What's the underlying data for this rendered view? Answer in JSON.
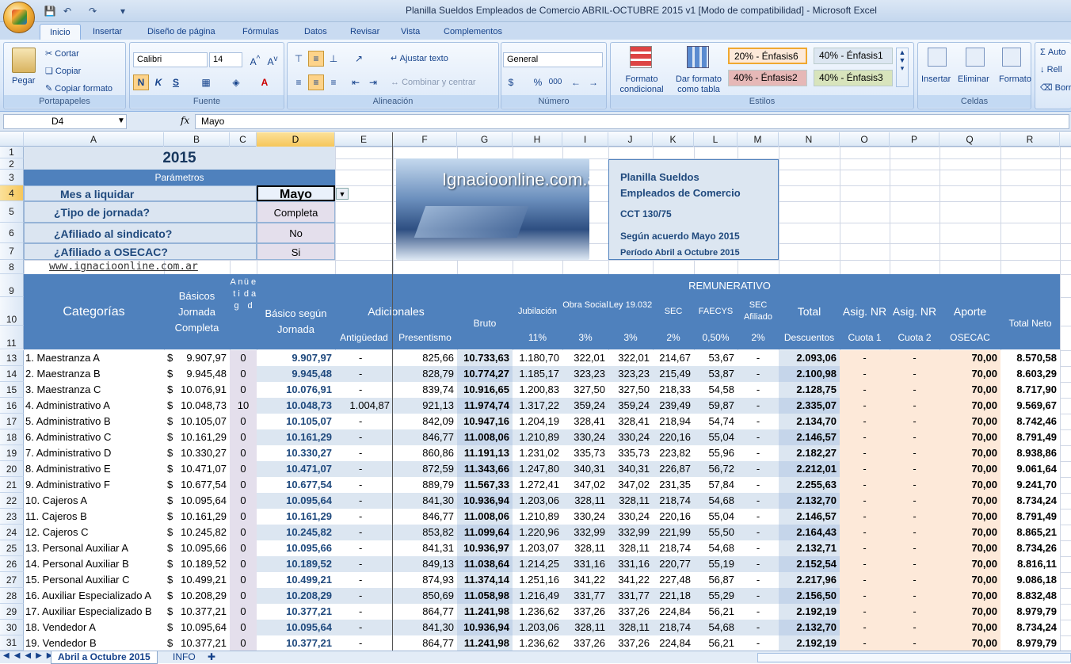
{
  "window": {
    "title": "Planilla Sueldos Empleados de Comercio ABRIL-OCTUBRE 2015 v1  [Modo de compatibilidad] - Microsoft Excel"
  },
  "tabs": [
    "Inicio",
    "Insertar",
    "Diseño de página",
    "Fórmulas",
    "Datos",
    "Revisar",
    "Vista",
    "Complementos"
  ],
  "ribbon": {
    "clipboard": {
      "label": "Portapapeles",
      "paste": "Pegar",
      "cut": "Cortar",
      "copy": "Copiar",
      "format_painter": "Copiar formato"
    },
    "font": {
      "label": "Fuente",
      "name": "Calibri",
      "size": "14",
      "bold": "N",
      "italic": "K",
      "underline": "S"
    },
    "alignment": {
      "label": "Alineación",
      "wrap": "Ajustar texto",
      "merge": "Combinar y centrar"
    },
    "number": {
      "label": "Número",
      "format": "General",
      "currency": "$",
      "percent": "%",
      "thousands": "000"
    },
    "styles": {
      "label": "Estilos",
      "conditional": "Formato condicional",
      "as_table": "Dar formato como tabla",
      "cells": [
        "20% - Énfasis6",
        "40% - Énfasis1",
        "40% - Énfasis2",
        "40% - Énfasis3"
      ],
      "cell_colors": [
        "#fde9d9",
        "#dce6f1",
        "#e6b8b7",
        "#d8e4bc"
      ]
    },
    "cells": {
      "label": "Celdas",
      "insert": "Insertar",
      "delete": "Eliminar",
      "format": "Formato"
    },
    "editing": {
      "items": [
        "Auto",
        "Rell",
        "Borr"
      ]
    }
  },
  "formula_bar": {
    "name_box": "D4",
    "fx": "fx",
    "value": "Mayo"
  },
  "columns": [
    "A",
    "B",
    "C",
    "D",
    "E",
    "F",
    "G",
    "H",
    "I",
    "J",
    "K",
    "L",
    "M",
    "N",
    "O",
    "P",
    "Q",
    "R"
  ],
  "rows": [
    "1",
    "2",
    "3",
    "4",
    "5",
    "6",
    "7",
    "8",
    "9",
    "10",
    "11",
    "13",
    "14",
    "15",
    "16",
    "17",
    "18",
    "19",
    "20",
    "21",
    "22",
    "23",
    "24",
    "25",
    "26",
    "27",
    "28",
    "29",
    "30",
    "31"
  ],
  "params": {
    "year": "2015",
    "title": "Parámetros",
    "mes_label": "Mes a liquidar",
    "mes_value": "Mayo",
    "jornada_label": "¿Tipo de jornada?",
    "jornada_value": "Completa",
    "sindicato_label": "¿Afiliado al sindicato?",
    "sindicato_value": "No",
    "osecac_label": "¿Afiliado a OSECAC?",
    "osecac_value": "Si",
    "website": "www.ignacioonline.com.ar"
  },
  "banner": {
    "logo_text": "Ignacioonline.com.ar",
    "info": [
      "Planilla Sueldos",
      "Empleados de Comercio",
      "CCT 130/75",
      "Según acuerdo Mayo 2015",
      "Período Abril a Octubre 2015"
    ]
  },
  "headers": {
    "categorias": "Categorías",
    "basicos": "Básicos Jornada Completa",
    "antig": "A n t i g",
    "edad": "ü e d a d",
    "basico_jornada": "Básico según Jornada",
    "adicionales": "Adicionales",
    "antiguedad": "Antigüedad",
    "presentismo": "Presentismo",
    "remunerativo": "REMUNERATIVO",
    "bruto": "Bruto",
    "jubilacion": "Jubilación",
    "jub_pct": "11%",
    "obra_social": "Obra Social",
    "os_pct": "3%",
    "ley": "Ley 19.032",
    "ley_pct": "3%",
    "sec": "SEC",
    "sec_pct": "2%",
    "faecys": "FAECYS",
    "faecys_pct": "0,50%",
    "sec_afiliado": "SEC Afiliado",
    "seca_pct": "2%",
    "total": "Total",
    "descuentos": "Descuentos",
    "asig1": "Asig. NR",
    "cuota1": "Cuota 1",
    "asig2": "Asig. NR",
    "cuota2": "Cuota 2",
    "aporte": "Aporte",
    "osecac": "OSECAC",
    "total_neto": "Total Neto"
  },
  "table": [
    [
      "1. Maestranza A",
      "$",
      "9.907,97",
      "0",
      "9.907,97",
      "-",
      "825,66",
      "10.733,63",
      "1.180,70",
      "322,01",
      "322,01",
      "214,67",
      "53,67",
      "-",
      "2.093,06",
      "-",
      "-",
      "70,00",
      "8.570,58"
    ],
    [
      "2. Maestranza B",
      "$",
      "9.945,48",
      "0",
      "9.945,48",
      "-",
      "828,79",
      "10.774,27",
      "1.185,17",
      "323,23",
      "323,23",
      "215,49",
      "53,87",
      "-",
      "2.100,98",
      "-",
      "-",
      "70,00",
      "8.603,29"
    ],
    [
      "3. Maestranza C",
      "$",
      "10.076,91",
      "0",
      "10.076,91",
      "-",
      "839,74",
      "10.916,65",
      "1.200,83",
      "327,50",
      "327,50",
      "218,33",
      "54,58",
      "-",
      "2.128,75",
      "-",
      "-",
      "70,00",
      "8.717,90"
    ],
    [
      "4. Administrativo A",
      "$",
      "10.048,73",
      "10",
      "10.048,73",
      "1.004,87",
      "921,13",
      "11.974,74",
      "1.317,22",
      "359,24",
      "359,24",
      "239,49",
      "59,87",
      "-",
      "2.335,07",
      "-",
      "-",
      "70,00",
      "9.569,67"
    ],
    [
      "5. Administrativo B",
      "$",
      "10.105,07",
      "0",
      "10.105,07",
      "-",
      "842,09",
      "10.947,16",
      "1.204,19",
      "328,41",
      "328,41",
      "218,94",
      "54,74",
      "-",
      "2.134,70",
      "-",
      "-",
      "70,00",
      "8.742,46"
    ],
    [
      "6. Administrativo C",
      "$",
      "10.161,29",
      "0",
      "10.161,29",
      "-",
      "846,77",
      "11.008,06",
      "1.210,89",
      "330,24",
      "330,24",
      "220,16",
      "55,04",
      "-",
      "2.146,57",
      "-",
      "-",
      "70,00",
      "8.791,49"
    ],
    [
      "7. Administrativo D",
      "$",
      "10.330,27",
      "0",
      "10.330,27",
      "-",
      "860,86",
      "11.191,13",
      "1.231,02",
      "335,73",
      "335,73",
      "223,82",
      "55,96",
      "-",
      "2.182,27",
      "-",
      "-",
      "70,00",
      "8.938,86"
    ],
    [
      "8. Administrativo E",
      "$",
      "10.471,07",
      "0",
      "10.471,07",
      "-",
      "872,59",
      "11.343,66",
      "1.247,80",
      "340,31",
      "340,31",
      "226,87",
      "56,72",
      "-",
      "2.212,01",
      "-",
      "-",
      "70,00",
      "9.061,64"
    ],
    [
      "9. Administrativo F",
      "$",
      "10.677,54",
      "0",
      "10.677,54",
      "-",
      "889,79",
      "11.567,33",
      "1.272,41",
      "347,02",
      "347,02",
      "231,35",
      "57,84",
      "-",
      "2.255,63",
      "-",
      "-",
      "70,00",
      "9.241,70"
    ],
    [
      "10. Cajeros A",
      "$",
      "10.095,64",
      "0",
      "10.095,64",
      "-",
      "841,30",
      "10.936,94",
      "1.203,06",
      "328,11",
      "328,11",
      "218,74",
      "54,68",
      "-",
      "2.132,70",
      "-",
      "-",
      "70,00",
      "8.734,24"
    ],
    [
      "11. Cajeros B",
      "$",
      "10.161,29",
      "0",
      "10.161,29",
      "-",
      "846,77",
      "11.008,06",
      "1.210,89",
      "330,24",
      "330,24",
      "220,16",
      "55,04",
      "-",
      "2.146,57",
      "-",
      "-",
      "70,00",
      "8.791,49"
    ],
    [
      "12. Cajeros C",
      "$",
      "10.245,82",
      "0",
      "10.245,82",
      "-",
      "853,82",
      "11.099,64",
      "1.220,96",
      "332,99",
      "332,99",
      "221,99",
      "55,50",
      "-",
      "2.164,43",
      "-",
      "-",
      "70,00",
      "8.865,21"
    ],
    [
      "13. Personal Auxiliar A",
      "$",
      "10.095,66",
      "0",
      "10.095,66",
      "-",
      "841,31",
      "10.936,97",
      "1.203,07",
      "328,11",
      "328,11",
      "218,74",
      "54,68",
      "-",
      "2.132,71",
      "-",
      "-",
      "70,00",
      "8.734,26"
    ],
    [
      "14. Personal Auxiliar B",
      "$",
      "10.189,52",
      "0",
      "10.189,52",
      "-",
      "849,13",
      "11.038,64",
      "1.214,25",
      "331,16",
      "331,16",
      "220,77",
      "55,19",
      "-",
      "2.152,54",
      "-",
      "-",
      "70,00",
      "8.816,11"
    ],
    [
      "15. Personal Auxiliar C",
      "$",
      "10.499,21",
      "0",
      "10.499,21",
      "-",
      "874,93",
      "11.374,14",
      "1.251,16",
      "341,22",
      "341,22",
      "227,48",
      "56,87",
      "-",
      "2.217,96",
      "-",
      "-",
      "70,00",
      "9.086,18"
    ],
    [
      "16. Auxiliar Especializado A",
      "$",
      "10.208,29",
      "0",
      "10.208,29",
      "-",
      "850,69",
      "11.058,98",
      "1.216,49",
      "331,77",
      "331,77",
      "221,18",
      "55,29",
      "-",
      "2.156,50",
      "-",
      "-",
      "70,00",
      "8.832,48"
    ],
    [
      "17. Auxiliar Especializado B",
      "$",
      "10.377,21",
      "0",
      "10.377,21",
      "-",
      "864,77",
      "11.241,98",
      "1.236,62",
      "337,26",
      "337,26",
      "224,84",
      "56,21",
      "-",
      "2.192,19",
      "-",
      "-",
      "70,00",
      "8.979,79"
    ],
    [
      "18. Vendedor A",
      "$",
      "10.095,64",
      "0",
      "10.095,64",
      "-",
      "841,30",
      "10.936,94",
      "1.203,06",
      "328,11",
      "328,11",
      "218,74",
      "54,68",
      "-",
      "2.132,70",
      "-",
      "-",
      "70,00",
      "8.734,24"
    ],
    [
      "19. Vendedor B",
      "$",
      "10.377,21",
      "0",
      "10.377,21",
      "-",
      "864,77",
      "11.241,98",
      "1.236,62",
      "337,26",
      "337,26",
      "224,84",
      "56,21",
      "-",
      "2.192,19",
      "-",
      "-",
      "70,00",
      "8.979,79"
    ]
  ],
  "sheets": [
    "Abril a Octubre 2015",
    "INFO"
  ]
}
